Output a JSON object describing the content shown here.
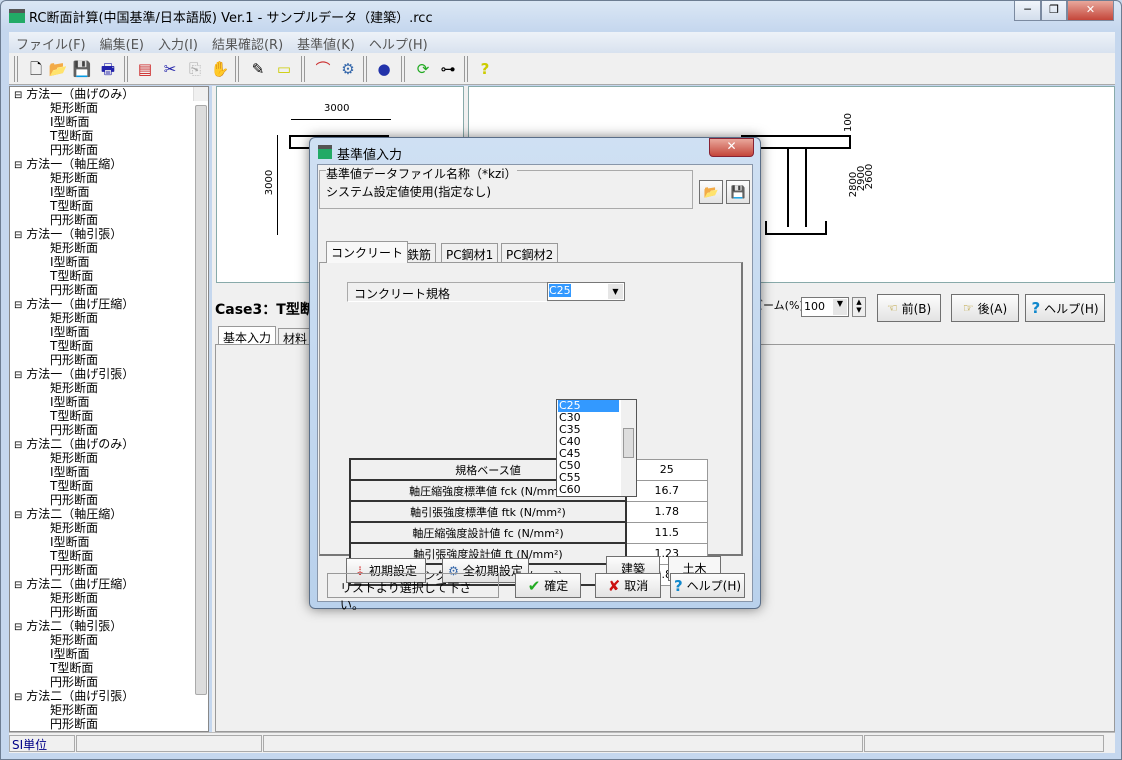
{
  "window": {
    "title": "RC断面計算(中国基準/日本語版) Ver.1 - サンプルデータ（建築）.rcc",
    "controls": [
      "─",
      "❐",
      "✕"
    ]
  },
  "menu": [
    "ファイル(F)",
    "編集(E)",
    "入力(I)",
    "結果確認(R)",
    "基準値(K)",
    "ヘルプ(H)"
  ],
  "toolbar_icons": [
    "new-file",
    "open-folder",
    "save",
    "print",
    "import",
    "cut",
    "copy",
    "clear",
    "export",
    "print-preview",
    "graph",
    "calc",
    "globe",
    "refresh",
    "tree",
    "help"
  ],
  "tree": [
    {
      "label": "方法一（曲げのみ）",
      "items": [
        "矩形断面",
        "I型断面",
        "T型断面",
        "円形断面"
      ]
    },
    {
      "label": "方法一（軸圧縮）",
      "items": [
        "矩形断面",
        "I型断面",
        "T型断面",
        "円形断面"
      ]
    },
    {
      "label": "方法一（軸引張）",
      "items": [
        "矩形断面",
        "I型断面",
        "T型断面",
        "円形断面"
      ]
    },
    {
      "label": "方法一（曲げ圧縮）",
      "items": [
        "矩形断面",
        "I型断面",
        "T型断面",
        "円形断面"
      ]
    },
    {
      "label": "方法一（曲げ引張）",
      "items": [
        "矩形断面",
        "I型断面",
        "T型断面",
        "円形断面"
      ]
    },
    {
      "label": "方法二（曲げのみ）",
      "items": [
        "矩形断面",
        "I型断面",
        "T型断面",
        "円形断面"
      ]
    },
    {
      "label": "方法二（軸圧縮）",
      "items": [
        "矩形断面",
        "I型断面",
        "T型断面",
        "円形断面"
      ]
    },
    {
      "label": "方法二（曲げ圧縮）",
      "items": [
        "矩形断面",
        "円形断面"
      ]
    },
    {
      "label": "方法二（軸引張）",
      "items": [
        "矩形断面",
        "I型断面",
        "T型断面",
        "円形断面"
      ]
    },
    {
      "label": "方法二（曲げ引張）",
      "items": [
        "矩形断面",
        "円形断面"
      ]
    }
  ],
  "drawing": {
    "dim_width": "3000",
    "dim_height": "3000",
    "dim_top": "100",
    "dim_right_1": "2800",
    "dim_right_2": "2900",
    "dim_right_3": "2600"
  },
  "case_title": "Case3：T型断面",
  "main_tabs": [
    "基本入力",
    "材料"
  ],
  "zoom": {
    "label": "ズーム(%)",
    "value": "100"
  },
  "nav_buttons": {
    "prev": "前(B)",
    "next": "後(A)",
    "help": "ヘルプ(H)"
  },
  "status_bar": {
    "unit": "SI単位"
  },
  "dialog": {
    "title": "基準値入力",
    "file_group_label": "基準値データファイル名称（*kzi）",
    "file_value": "システム設定値使用(指定なし)",
    "tabs": [
      "コンクリート",
      "鉄筋",
      "PC鋼材1",
      "PC鋼材2"
    ],
    "grade_label": "コンクリート規格",
    "grade_value": "C25",
    "grade_options": [
      "C25",
      "C30",
      "C35",
      "C40",
      "C45",
      "C50",
      "C55",
      "C60"
    ],
    "table": [
      {
        "label": "規格ベース値",
        "value": "25"
      },
      {
        "label": "軸圧縮強度標準値 fck (N/mm²)",
        "value": "16.7"
      },
      {
        "label": "軸引張強度標準値 ftk (N/mm²)",
        "value": "1.78"
      },
      {
        "label": "軸圧縮強度設計値 fc (N/mm²)",
        "value": "11.5"
      },
      {
        "label": "軸引張強度設計値 ft (N/mm²)",
        "value": "1.23"
      },
      {
        "label": "ヤング係数 Ec (×10⁴N/mm²)",
        "value": "2.80"
      }
    ],
    "init_button": "初期設定",
    "all_init_button": "全初期設定",
    "arch_button": "建築",
    "civil_button": "土木",
    "message": "リストより選択して下さい。",
    "ok_button": "確定",
    "cancel_button": "取消",
    "help_button": "ヘルプ(H)"
  }
}
